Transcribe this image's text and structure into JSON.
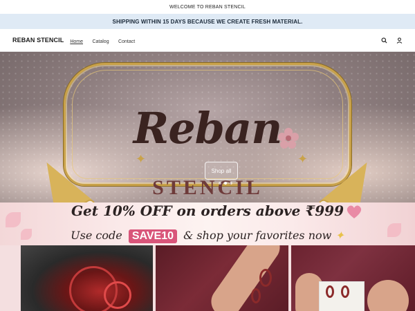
{
  "announcement": {
    "text": "WELCOME TO REBAN STENCIL"
  },
  "shipping_bar": {
    "text": "SHIPPING WITHIN 15 DAYS BECAUSE WE CREATE FRESH MATERIAL."
  },
  "header": {
    "logo": "REBAN STENCIL",
    "nav": [
      {
        "label": "Home"
      },
      {
        "label": "Catalog"
      },
      {
        "label": "Contact"
      }
    ],
    "icons": [
      "search-icon",
      "account-icon"
    ]
  },
  "hero": {
    "title": "Reban",
    "subtitle": "STENCIL",
    "button_label": "Shop all",
    "slides": 3,
    "active_slide": 1
  },
  "promo": {
    "headline": "Get 10% OFF on orders above ₹999",
    "line2_prefix": "Use code",
    "code": "SAVE10",
    "line2_suffix": "& shop your favorites now"
  },
  "colors": {
    "shipping_bg": "#dfeaf5",
    "accent_pink": "#d9557a",
    "gold": "#c9a24a",
    "title_brown": "#3a2320"
  }
}
